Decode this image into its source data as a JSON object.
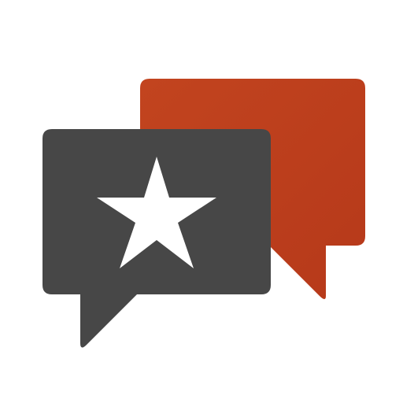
{
  "logo": {
    "back_bubble_color": "#b6391a",
    "back_bubble_color_light": "#c2441f",
    "front_bubble_color": "#474747",
    "star_color": "#ffffff",
    "icons": [
      "chat-bubble-icon",
      "chat-bubble-icon",
      "star-icon"
    ]
  }
}
